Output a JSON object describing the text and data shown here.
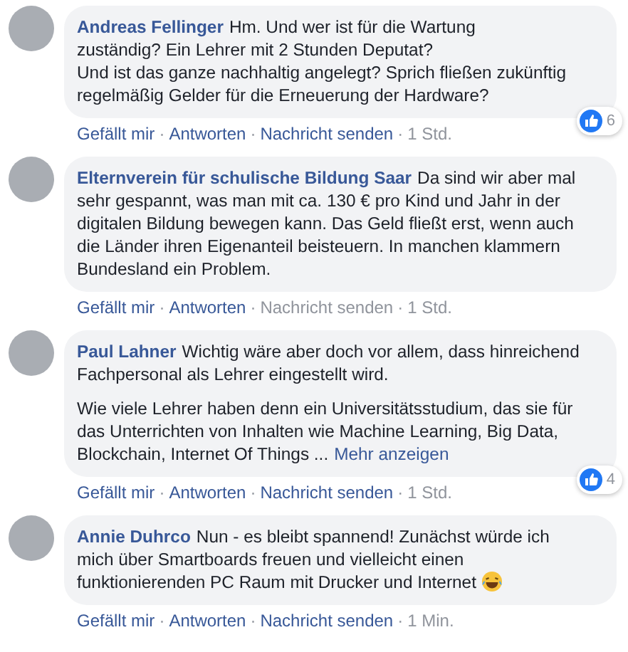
{
  "separator": "·",
  "comments": [
    {
      "kind": "plain",
      "author": "Andreas Fellinger",
      "paragraphs": [
        "Hm. Und wer ist für die Wartung\nzuständig? Ein Lehrer mit 2 Stunden Deputat?\nUnd ist das ganze nachhaltig angelegt? Sprich fließen zukünftig regelmäßig Gelder für die Erneuerung der Hardware?"
      ],
      "actions": [
        {
          "label": "Gefällt mir",
          "disabled": false
        },
        {
          "label": "Antworten",
          "disabled": false
        },
        {
          "label": "Nachricht senden",
          "disabled": false
        }
      ],
      "time": "1 Std.",
      "likes": "6"
    },
    {
      "kind": "plain",
      "author": "Elternverein für schulische Bildung Saar",
      "paragraphs": [
        "Da sind wir aber mal sehr gespannt, was man mit ca. 130 € pro Kind und Jahr in der digitalen Bildung bewegen kann. Das Geld fließt erst, wenn auch die Länder ihren Eigenanteil beisteuern. In manchen klammern Bundesland ein Problem."
      ],
      "actions": [
        {
          "label": "Gefällt mir",
          "disabled": false
        },
        {
          "label": "Antworten",
          "disabled": false
        },
        {
          "label": "Nachricht senden",
          "disabled": true
        }
      ],
      "time": "1 Std."
    },
    {
      "kind": "plain",
      "author": "Paul Lahner",
      "paragraphs": [
        "Wichtig wäre aber doch vor allem, dass hinreichend Fachpersonal als Lehrer eingestellt wird.",
        "Wie viele Lehrer haben denn ein Universitätsstudium, das sie für das Unterrichten von Inhalten wie Machine Learning, Big Data, Blockchain, Internet Of Things ..."
      ],
      "more_link": "Mehr anzeigen",
      "actions": [
        {
          "label": "Gefällt mir",
          "disabled": false
        },
        {
          "label": "Antworten",
          "disabled": false
        },
        {
          "label": "Nachricht senden",
          "disabled": false
        }
      ],
      "time": "1 Std.",
      "likes": "4"
    },
    {
      "kind": "emoji",
      "author": "Annie Duhrco",
      "paragraphs": [
        "Nun - es bleibt spannend! Zunächst würde ich mich über Smartboards freuen und vielleicht einen funktionierenden PC Raum mit Drucker und Internet"
      ],
      "actions": [
        {
          "label": "Gefällt mir",
          "disabled": false
        },
        {
          "label": "Antworten",
          "disabled": false
        },
        {
          "label": "Nachricht senden",
          "disabled": false
        }
      ],
      "time": "1 Min."
    }
  ]
}
